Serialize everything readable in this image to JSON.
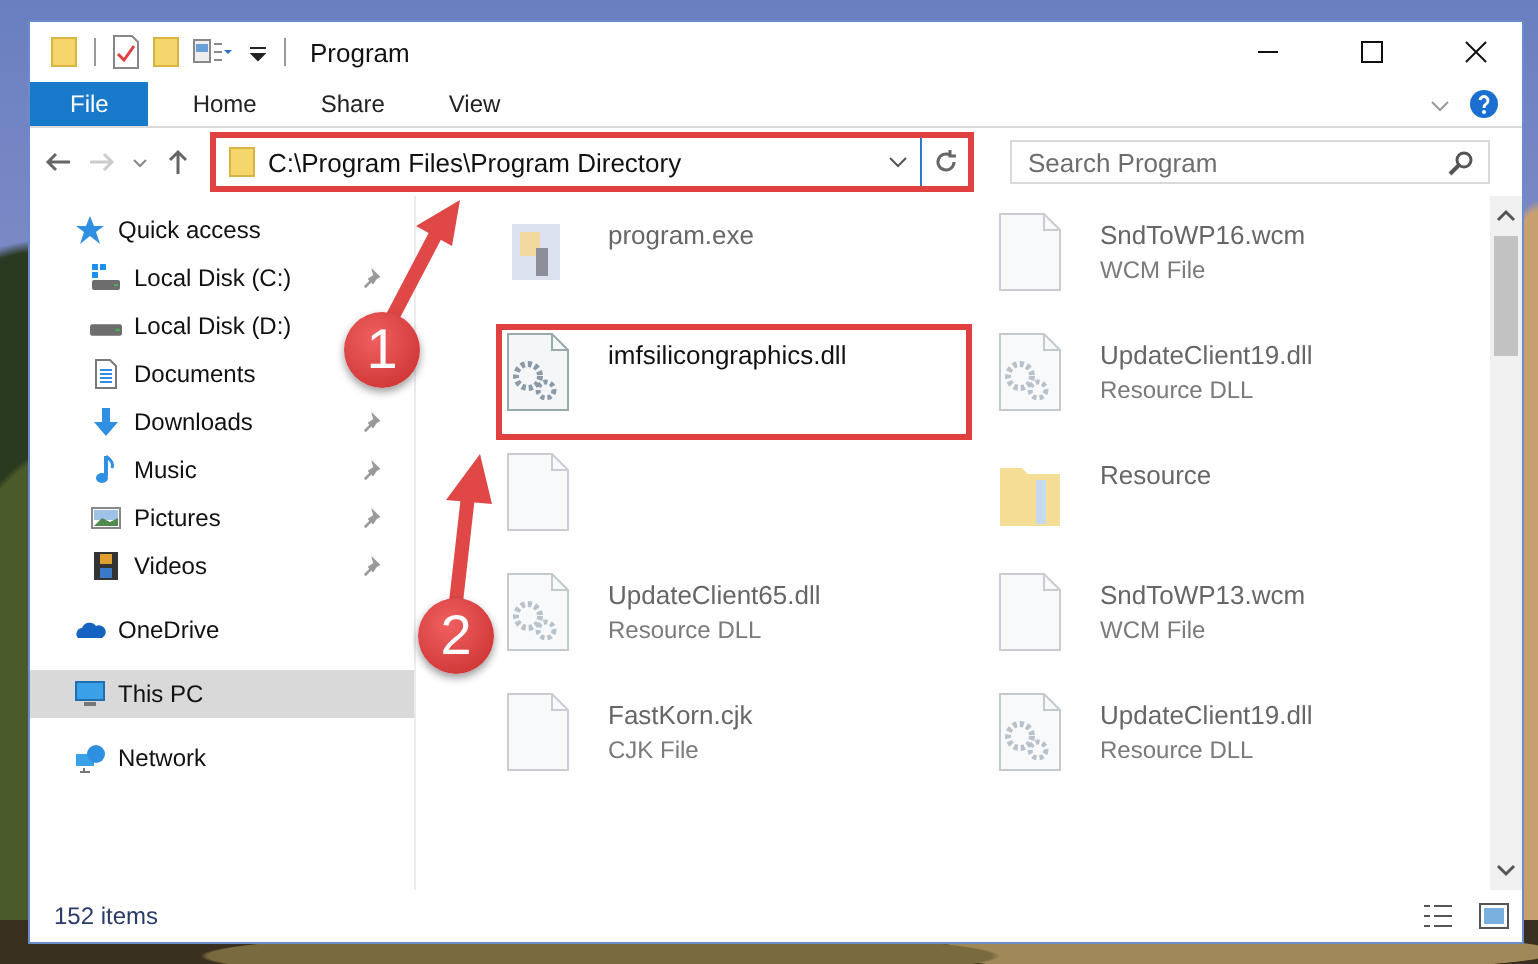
{
  "window": {
    "title": "Program"
  },
  "ribbon_tabs": [
    {
      "label": "File",
      "kind": "file"
    },
    {
      "label": "Home",
      "kind": "tab"
    },
    {
      "label": "Share",
      "kind": "tab"
    },
    {
      "label": "View",
      "kind": "tab"
    }
  ],
  "address": {
    "path": "C:\\Program Files\\Program Directory",
    "highlighted": true
  },
  "search": {
    "placeholder": "Search Program"
  },
  "sidebar": {
    "items": [
      {
        "label": "Quick access",
        "kind": "star",
        "selected": false,
        "children": [
          {
            "label": "Local Disk (C:)",
            "kind": "drive_windows",
            "pinned": true,
            "selected": false
          },
          {
            "label": "Local Disk (D:)",
            "kind": "drive",
            "pinned": false,
            "selected": false
          },
          {
            "label": "Documents",
            "kind": "documents",
            "pinned": false,
            "selected": false
          },
          {
            "label": "Downloads",
            "kind": "downloads",
            "pinned": true,
            "selected": false
          },
          {
            "label": "Music",
            "kind": "music",
            "pinned": true,
            "selected": false
          },
          {
            "label": "Pictures",
            "kind": "pictures",
            "pinned": true,
            "selected": false
          },
          {
            "label": "Videos",
            "kind": "videos",
            "pinned": true,
            "selected": false
          }
        ]
      },
      {
        "label": "OneDrive",
        "kind": "cloud",
        "selected": false
      },
      {
        "label": "This PC",
        "kind": "pc",
        "selected": true
      },
      {
        "label": "Network",
        "kind": "network",
        "selected": false
      }
    ]
  },
  "files": [
    {
      "name": "program.exe",
      "kind": "exe",
      "blurred": true
    },
    {
      "name": "SndToWP16.wcm",
      "type": "WCM File",
      "kind": "file",
      "blurred": true
    },
    {
      "name": "imfsilicongraphics.dll",
      "kind": "dll",
      "blurred": false,
      "highlighted": true
    },
    {
      "name": "UpdateClient19.dll",
      "type": "Resource DLL",
      "kind": "dll",
      "blurred": true
    },
    {
      "kind": "file",
      "blurred": true
    },
    {
      "name": "Resource",
      "kind": "folder",
      "blurred": true
    },
    {
      "name": "UpdateClient65.dll",
      "type": "Resource DLL",
      "kind": "dll",
      "blurred": true
    },
    {
      "name": "SndToWP13.wcm",
      "type": "WCM File",
      "kind": "file",
      "blurred": true
    },
    {
      "name": "FastKorn.cjk",
      "type": "CJK File",
      "kind": "file",
      "blurred": true
    },
    {
      "name": "UpdateClient19.dll",
      "type": "Resource DLL",
      "kind": "dll",
      "blurred": true
    }
  ],
  "status_bar": {
    "count": "152 items"
  },
  "annotations": [
    {
      "label": "1"
    },
    {
      "label": "2"
    }
  ]
}
